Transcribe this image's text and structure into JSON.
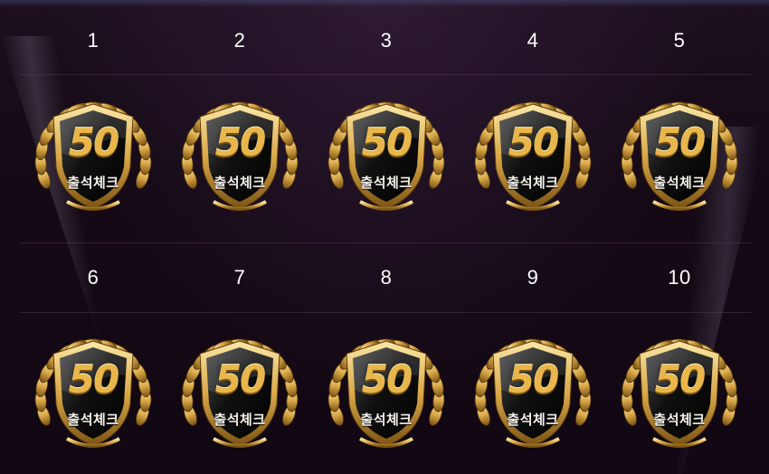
{
  "attendance": {
    "days": [
      {
        "day": "1",
        "badge_value": "50",
        "badge_label": "출석체크"
      },
      {
        "day": "2",
        "badge_value": "50",
        "badge_label": "출석체크"
      },
      {
        "day": "3",
        "badge_value": "50",
        "badge_label": "출석체크"
      },
      {
        "day": "4",
        "badge_value": "50",
        "badge_label": "출석체크"
      },
      {
        "day": "5",
        "badge_value": "50",
        "badge_label": "출석체크"
      },
      {
        "day": "6",
        "badge_value": "50",
        "badge_label": "출석체크"
      },
      {
        "day": "7",
        "badge_value": "50",
        "badge_label": "출석체크"
      },
      {
        "day": "8",
        "badge_value": "50",
        "badge_label": "출석체크"
      },
      {
        "day": "9",
        "badge_value": "50",
        "badge_label": "출석체크"
      },
      {
        "day": "10",
        "badge_value": "50",
        "badge_label": "출석체크"
      }
    ]
  },
  "colors": {
    "background": "#130812",
    "gold": "#d9a848",
    "gold_light": "#fbe7a6",
    "badge_dark": "#111111"
  },
  "icons": {
    "badge": "laurel-shield-icon"
  }
}
